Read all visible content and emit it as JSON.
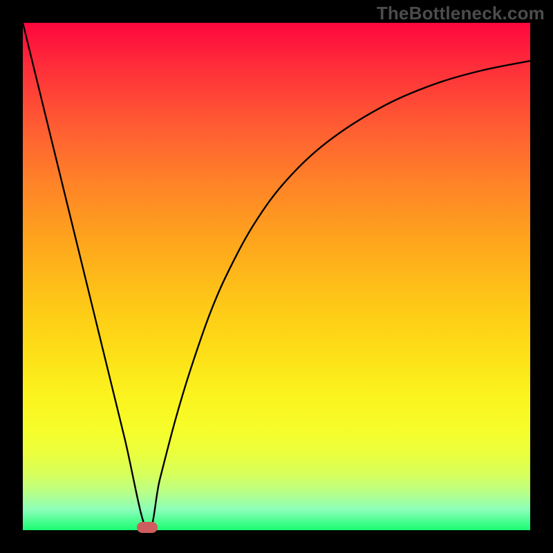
{
  "watermark": "TheBottleneck.com",
  "colors": {
    "frame": "#000000",
    "curve": "#000000",
    "marker": "#cd5d5e",
    "gradient_top": "#fe063e",
    "gradient_bottom": "#18fb70"
  },
  "chart_data": {
    "type": "line",
    "title": "",
    "xlabel": "",
    "ylabel": "",
    "xlim": [
      0,
      1
    ],
    "ylim": [
      0,
      1
    ],
    "note": "Axes are unlabeled; values are normalized fractions of the plot area. y=1 is top, y=0 is bottom. The curve depicts a V / check-mark shape: a steep linear descent to a minimum near x≈0.245, then a concave-increasing recovery.",
    "series": [
      {
        "name": "curve",
        "x": [
          0.0,
          0.05,
          0.1,
          0.15,
          0.2,
          0.245,
          0.27,
          0.3,
          0.33,
          0.37,
          0.41,
          0.46,
          0.52,
          0.6,
          0.7,
          0.8,
          0.9,
          1.0
        ],
        "y": [
          1.0,
          0.796,
          0.592,
          0.388,
          0.184,
          0.0,
          0.1,
          0.215,
          0.315,
          0.43,
          0.52,
          0.61,
          0.69,
          0.765,
          0.83,
          0.875,
          0.905,
          0.925
        ]
      }
    ],
    "annotations": [
      {
        "name": "minimum-marker",
        "x": 0.245,
        "y": 0.0,
        "shape": "pill"
      }
    ]
  }
}
